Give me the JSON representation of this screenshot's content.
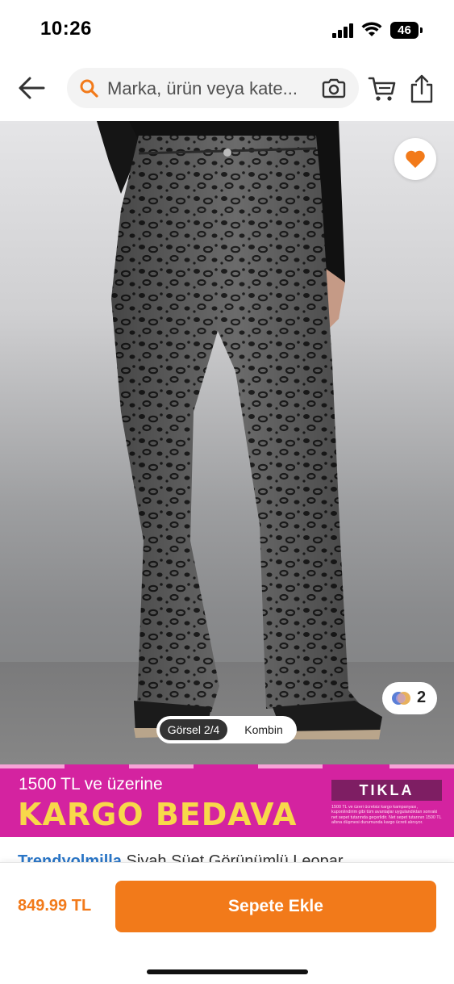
{
  "status_bar": {
    "time": "10:26",
    "battery": "46"
  },
  "search": {
    "placeholder": "Marka, ürün veya kate..."
  },
  "product_image": {
    "current_view": "Görsel 2/4",
    "other_view": "Kombin",
    "color_variant_count": "2"
  },
  "banner": {
    "line1": "1500 TL ve üzerine",
    "line2": "KARGO BEDAVA",
    "cta": "TIKLA",
    "fine_print": "1500 TL ve üzeri ücretsiz kargo kampanyası, kupon/indirim gibi tüm avantajlar uygulandıktan sonraki net sepet tutarında geçerlidir. Net sepet tutarının 1500 TL altına düşmesi durumunda kargo ücreti alınıyor."
  },
  "product": {
    "brand": "Trendyolmilla",
    "name": "Siyah Süet Görünümlü Leopar"
  },
  "purchase": {
    "price": "849.99 TL",
    "add_to_cart_label": "Sepete Ekle"
  },
  "colors": {
    "accent": "#f27a1a",
    "banner_bg": "#d423a0",
    "banner_headline": "#f8d84a",
    "brand_link": "#2a76c7"
  },
  "icons": {
    "back": "arrow-left-icon",
    "search": "search-icon",
    "camera": "camera-icon",
    "cart": "cart-icon",
    "share": "share-icon",
    "favorite": "heart-icon"
  }
}
